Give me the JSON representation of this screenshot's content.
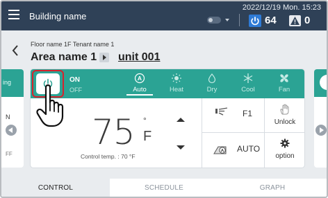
{
  "header": {
    "app_title": "Building name",
    "datetime_line": "2022/12/19 Mon. 15:23",
    "power_count": "64",
    "warning_count": "0"
  },
  "breadcrumb": {
    "floor_line": "Floor name 1F Tenant name 1",
    "area": "Area name 1",
    "unit": "unit 001"
  },
  "side_cards": {
    "left_partial_label": "ing",
    "left_n": "N",
    "left_ff": "FF"
  },
  "modebar": {
    "on_label": "ON",
    "off_label": "OFF",
    "modes": [
      {
        "label": "Auto",
        "icon": "auto-mode-icon",
        "active": true
      },
      {
        "label": "Heat",
        "icon": "sun-icon",
        "active": false
      },
      {
        "label": "Dry",
        "icon": "droplet-icon",
        "active": false
      },
      {
        "label": "Cool",
        "icon": "snowflake-icon",
        "active": false
      },
      {
        "label": "Fan",
        "icon": "fan-icon",
        "active": false
      }
    ]
  },
  "temperature": {
    "value": "75",
    "degree": "°",
    "unit": "F",
    "control_temp": "Control temp. : 70  °F"
  },
  "controls": {
    "fan_speed": "F1",
    "lock_label": "Unlock",
    "airflow_label": "AUTO",
    "option_label": "option"
  },
  "tabs": [
    {
      "label": "CONTROL",
      "active": true
    },
    {
      "label": "SCHEDULE",
      "active": false
    },
    {
      "label": "GRAPH",
      "active": false
    }
  ],
  "colors": {
    "header": "#2f4157",
    "teal": "#2ba394",
    "highlight": "#d8222d",
    "badge_blue": "#2f7bd6"
  }
}
